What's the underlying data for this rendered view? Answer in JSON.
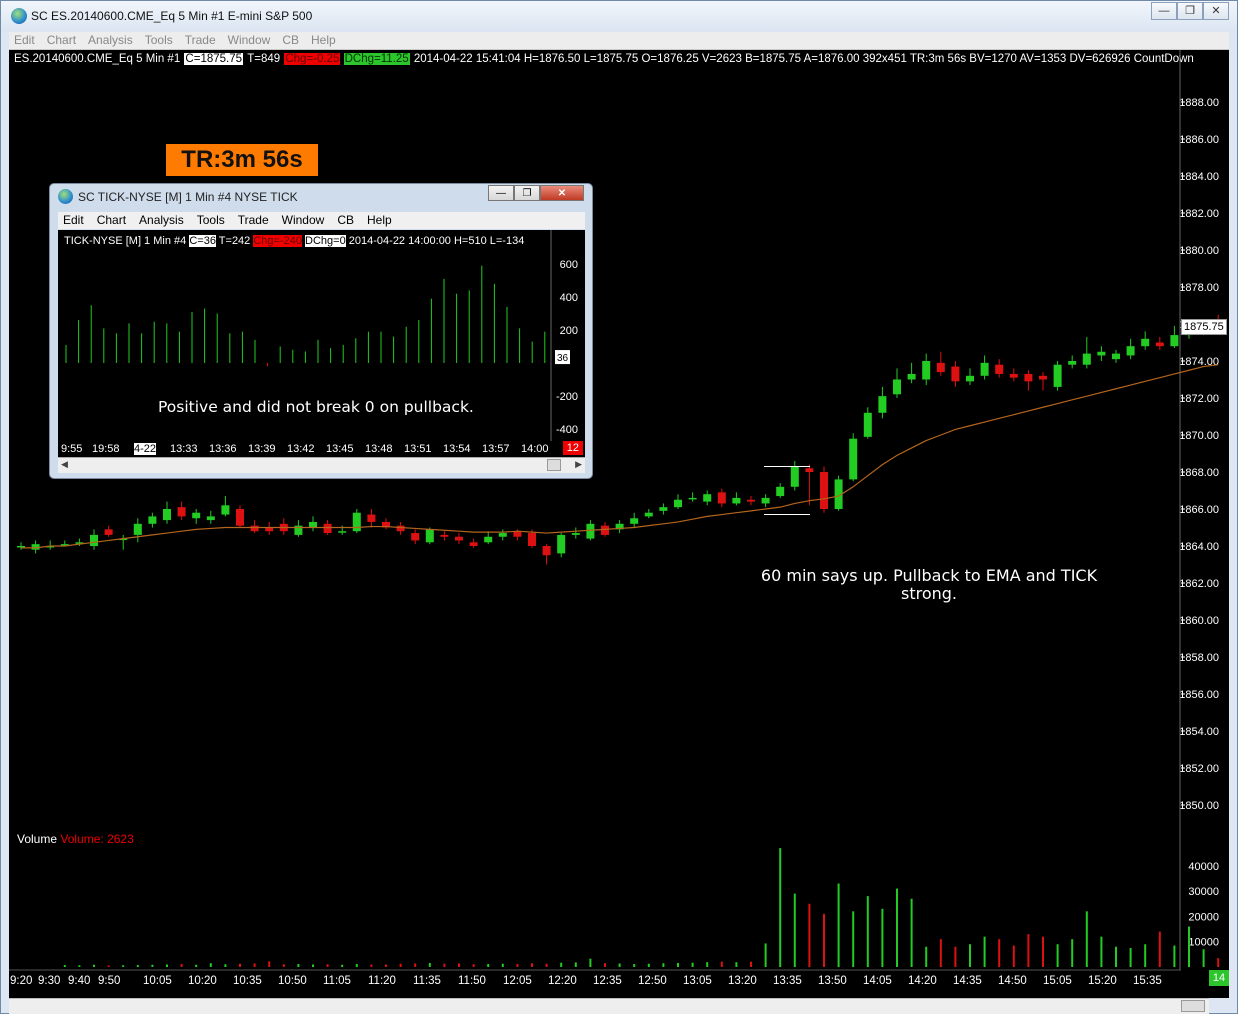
{
  "window": {
    "title": "SC ES.20140600.CME_Eq  5 Min   #1  E-mini S&P 500",
    "minimize": "—",
    "restore": "❐",
    "close": "✕"
  },
  "menu": [
    "Edit",
    "Chart",
    "Analysis",
    "Tools",
    "Trade",
    "Window",
    "CB",
    "Help"
  ],
  "infobar": {
    "symbol": "ES.20140600.CME_Eq  5 Min   #1",
    "c": "C=1875.75",
    "t": "T=849",
    "chg": "Chg=-0.25",
    "dchg": "DChg=11.25",
    "rest": "2014-04-22 15:41:04 H=1876.50 L=1875.75 O=1876.25 V=2623 B=1875.75 A=1876.00 392x451 TR:3m 56s BV=1270 AV=1353 DV=626926  CountDown"
  },
  "timer_box": "TR:3m 56s",
  "note_main": "60 min says up. Pullback to EMA and TICK strong.",
  "current_price": "1875.75",
  "price_axis": [
    "1888.00",
    "1886.00",
    "1884.00",
    "1882.00",
    "1880.00",
    "1878.00",
    "1876.00",
    "1874.00",
    "1872.00",
    "1870.00",
    "1868.00",
    "1866.00",
    "1864.00",
    "1862.00",
    "1860.00",
    "1858.00",
    "1856.00",
    "1854.00",
    "1852.00",
    "1850.00"
  ],
  "volume": {
    "title": "Volume",
    "value_label": "Volume: 2623",
    "axis": [
      "40000",
      "30000",
      "20000",
      "10000"
    ]
  },
  "time_axis": [
    "9:20",
    "9:30",
    "9:40",
    "9:50",
    "10:05",
    "10:20",
    "10:35",
    "10:50",
    "11:05",
    "11:20",
    "11:35",
    "11:50",
    "12:05",
    "12:20",
    "12:35",
    "12:50",
    "13:05",
    "13:20",
    "13:35",
    "13:50",
    "14:05",
    "14:20",
    "14:35",
    "14:50",
    "15:05",
    "15:20",
    "15:35"
  ],
  "badge": "14",
  "sub_window": {
    "title": "SC TICK-NYSE [M]  1 Min   #4  NYSE TICK",
    "menu": [
      "Edit",
      "Chart",
      "Analysis",
      "Tools",
      "Trade",
      "Window",
      "CB",
      "Help"
    ],
    "info_symbol": "TICK-NYSE [M]  1 Min   #4",
    "c": "C=36",
    "t": "T=242",
    "chg": "Chg=-240",
    "dchg": "DChg=0",
    "rest": "2014-04-22 14:00:00 H=510 L=-134",
    "note": "Positive and did not break 0 on pullback.",
    "y_axis": [
      "600",
      "400",
      "200",
      "-200",
      "-400"
    ],
    "current": "36",
    "x_axis": [
      "9:55",
      "19:58",
      "4-22",
      "13:33",
      "13:36",
      "13:39",
      "13:42",
      "13:45",
      "13:48",
      "13:51",
      "13:54",
      "13:57",
      "14:00"
    ],
    "badge": "12"
  },
  "colors": {
    "up": "#22cc22",
    "down": "#dd1111",
    "ema": "#b5651d",
    "accent": "#ff7b00"
  }
}
